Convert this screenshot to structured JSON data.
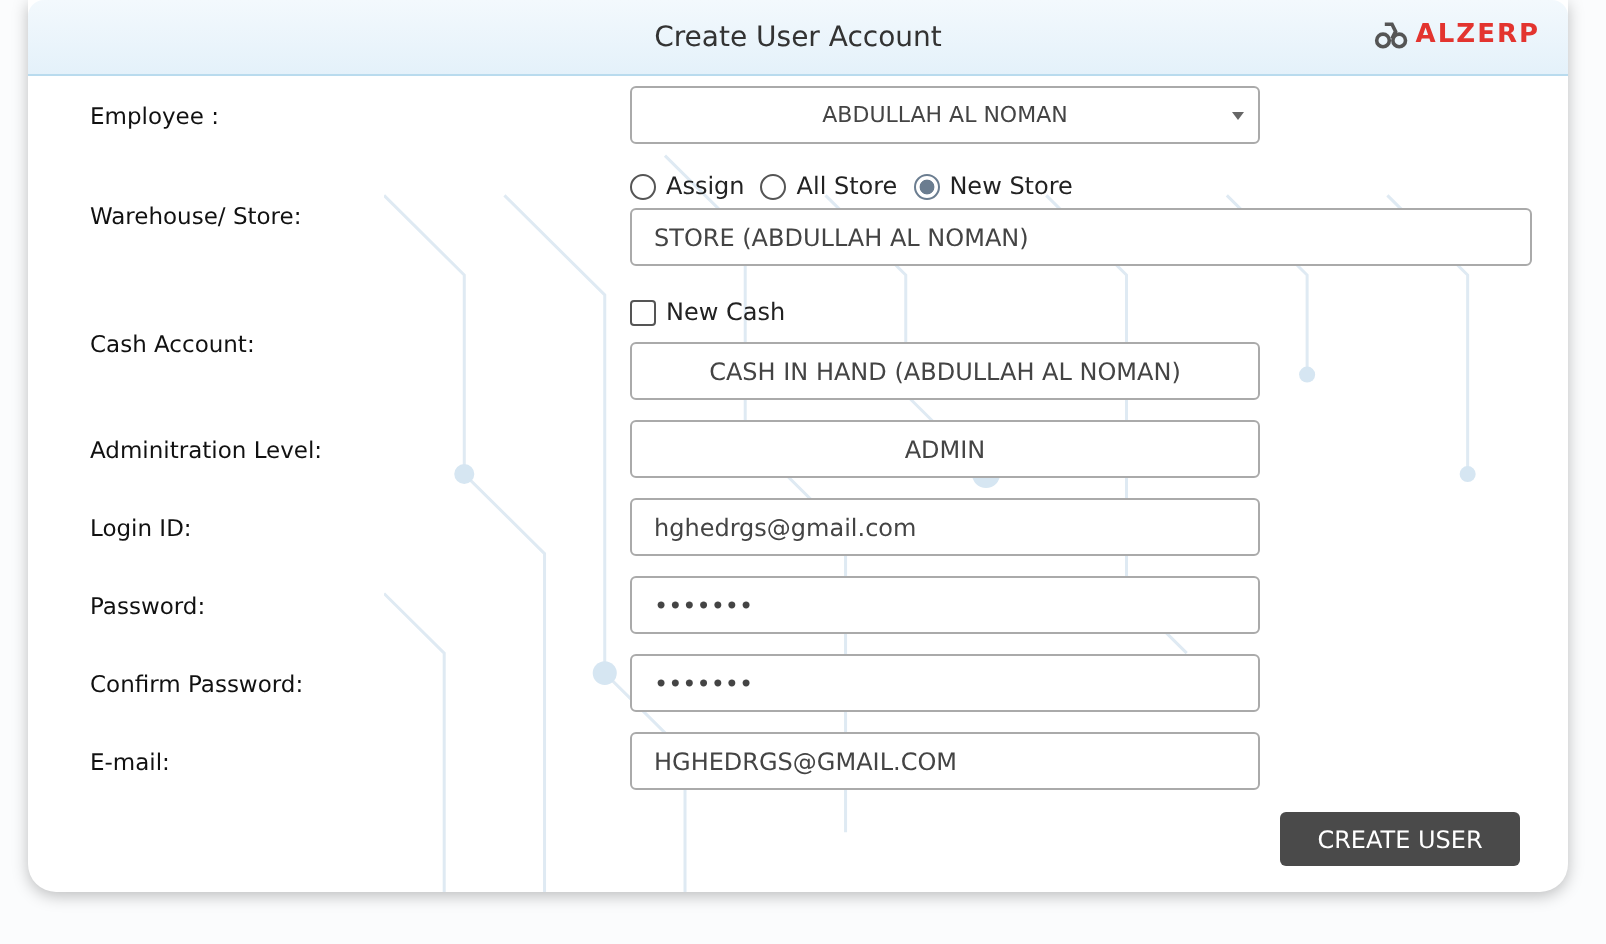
{
  "window": {
    "title": "Create User Account",
    "logo": "ALZERP"
  },
  "fields": [
    {
      "kind": "select",
      "label": "Employee :",
      "value": "ABDULLAH AL NOMAN"
    },
    {
      "kind": "store",
      "label": "Warehouse/ Store:",
      "options": [
        {
          "label": "Assign",
          "selected": false
        },
        {
          "label": "All Store",
          "selected": false
        },
        {
          "label": "New Store",
          "selected": true
        }
      ],
      "value": "STORE (ABDULLAH AL NOMAN)"
    },
    {
      "kind": "cash",
      "label": "Cash Account:",
      "check": {
        "label": "New Cash",
        "checked": false
      },
      "value": "CASH IN HAND (ABDULLAH AL NOMAN)"
    },
    {
      "kind": "readonly",
      "label": "Adminitration Level:",
      "value": "ADMIN"
    },
    {
      "kind": "text",
      "label": "Login ID:",
      "value": "hghedrgs@gmail.com"
    },
    {
      "kind": "text",
      "label": "Password:",
      "value": "•••••••"
    },
    {
      "kind": "text",
      "label": "Confirm Password:",
      "value": "•••••••"
    },
    {
      "kind": "text",
      "label": "E-mail:",
      "value": "HGHEDRGS@GMAIL.COM"
    }
  ],
  "buttons": [
    "CREATE USER"
  ]
}
